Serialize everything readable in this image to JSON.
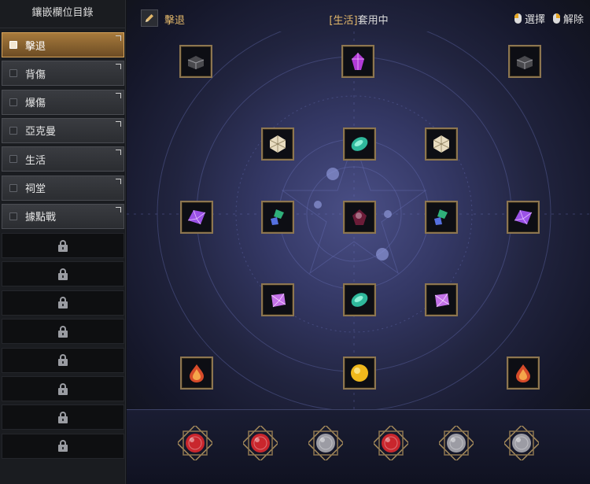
{
  "sidebar": {
    "title": "鑲嵌欄位目錄",
    "presets": [
      {
        "label": "擊退",
        "active": true
      },
      {
        "label": "背傷",
        "active": false
      },
      {
        "label": "爆傷",
        "active": false
      },
      {
        "label": "亞克曼",
        "active": false
      },
      {
        "label": "生活",
        "active": false
      },
      {
        "label": "祠堂",
        "active": false
      },
      {
        "label": "據點戰",
        "active": false
      }
    ],
    "locked_slot_count": 8
  },
  "header": {
    "preset_name": "擊退",
    "status_tag": "[生活]",
    "status_text": "套用中",
    "select_label": "選擇",
    "remove_label": "解除"
  },
  "gems": [
    {
      "kind": "black-box",
      "color": "#6d6d6d"
    },
    {
      "kind": "purple-crystal",
      "color": "#b23bd6"
    },
    {
      "kind": "black-box",
      "color": "#6d6d6d"
    },
    {
      "kind": "white-prism",
      "color": "#e8dcc0"
    },
    {
      "kind": "green-stone",
      "color": "#2fb89c"
    },
    {
      "kind": "white-prism",
      "color": "#e8dcc0"
    },
    {
      "kind": "violet-shard",
      "color": "#9b52e6"
    },
    {
      "kind": "green-blue-cluster",
      "color": "#2fb07a"
    },
    {
      "kind": "dark-red-core",
      "color": "#6b1c38"
    },
    {
      "kind": "green-blue-cluster",
      "color": "#2fb07a"
    },
    {
      "kind": "violet-shard",
      "color": "#9b52e6"
    },
    {
      "kind": "violet-gem",
      "color": "#c472e8"
    },
    {
      "kind": "green-stone",
      "color": "#2fb89c"
    },
    {
      "kind": "violet-gem",
      "color": "#c472e8"
    },
    {
      "kind": "fire-drop",
      "color": "#d64b2a"
    },
    {
      "kind": "gold-orb",
      "color": "#f0b81c"
    },
    {
      "kind": "fire-drop",
      "color": "#d64b2a"
    }
  ],
  "bottom_gems": [
    {
      "kind": "red-round",
      "color": "#c9262d"
    },
    {
      "kind": "red-round",
      "color": "#c9262d"
    },
    {
      "kind": "silver-round",
      "color": "#9c9ca4"
    },
    {
      "kind": "red-round",
      "color": "#c9262d"
    },
    {
      "kind": "silver-round",
      "color": "#9c9ca4"
    },
    {
      "kind": "silver-round",
      "color": "#9c9ca4"
    }
  ],
  "colors": {
    "accent_gold": "#e2b76a",
    "active_preset": "#a77a3c",
    "slot_frame": "#8d7650"
  }
}
